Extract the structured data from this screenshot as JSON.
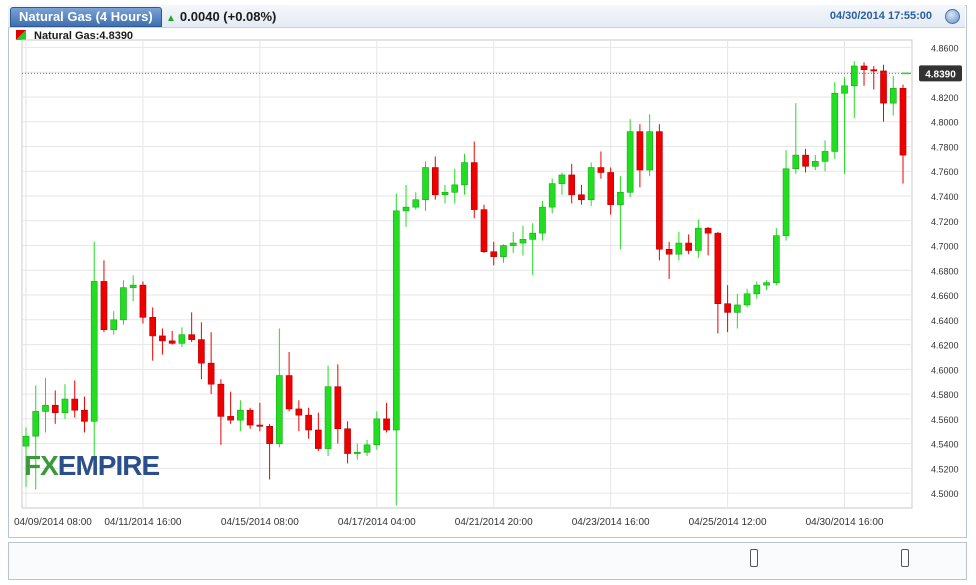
{
  "header": {
    "title": "Natural Gas (4 Hours)",
    "change": "0.0040 (+0.08%)",
    "datetime": "04/30/2014 17:55:00"
  },
  "legend": {
    "label": "Natural Gas:4.8390"
  },
  "watermark": {
    "fx": "FX",
    "rest": "EMPIRE"
  },
  "colors": {
    "up": "#22dd22",
    "down": "#ee0000",
    "axis_text": "#333333",
    "grid": "#e6e6e6",
    "price_tag": "#333333"
  },
  "chart_data": {
    "type": "candlestick",
    "title": "Natural Gas (4 Hours)",
    "ylim": [
      4.488,
      4.866
    ],
    "y_ticks": [
      "4.8600",
      "4.8400",
      "4.8200",
      "4.8000",
      "4.7800",
      "4.7600",
      "4.7400",
      "4.7200",
      "4.7000",
      "4.6800",
      "4.6600",
      "4.6400",
      "4.6200",
      "4.6000",
      "4.5800",
      "4.5600",
      "4.5400",
      "4.5200",
      "4.5000"
    ],
    "x_ticks": [
      {
        "index": 0,
        "label": "04/09/2014 08:00"
      },
      {
        "index": 12,
        "label": "04/11/2014 16:00"
      },
      {
        "index": 24,
        "label": "04/15/2014 08:00"
      },
      {
        "index": 36,
        "label": "04/17/2014 04:00"
      },
      {
        "index": 48,
        "label": "04/21/2014 20:00"
      },
      {
        "index": 60,
        "label": "04/23/2014 16:00"
      },
      {
        "index": 72,
        "label": "04/25/2014 12:00"
      },
      {
        "index": 84,
        "label": "04/30/2014 16:00"
      }
    ],
    "last_price": "4.8390",
    "candles": [
      {
        "o": 4.538,
        "h": 4.553,
        "l": 4.505,
        "c": 4.546
      },
      {
        "o": 4.546,
        "h": 4.587,
        "l": 4.503,
        "c": 4.566
      },
      {
        "o": 4.566,
        "h": 4.593,
        "l": 4.549,
        "c": 4.571
      },
      {
        "o": 4.571,
        "h": 4.583,
        "l": 4.556,
        "c": 4.565
      },
      {
        "o": 4.565,
        "h": 4.588,
        "l": 4.56,
        "c": 4.576
      },
      {
        "o": 4.576,
        "h": 4.591,
        "l": 4.561,
        "c": 4.567
      },
      {
        "o": 4.567,
        "h": 4.578,
        "l": 4.549,
        "c": 4.558
      },
      {
        "o": 4.558,
        "h": 4.703,
        "l": 4.527,
        "c": 4.671
      },
      {
        "o": 4.671,
        "h": 4.688,
        "l": 4.63,
        "c": 4.632
      },
      {
        "o": 4.632,
        "h": 4.647,
        "l": 4.628,
        "c": 4.64
      },
      {
        "o": 4.64,
        "h": 4.672,
        "l": 4.636,
        "c": 4.666
      },
      {
        "o": 4.666,
        "h": 4.676,
        "l": 4.655,
        "c": 4.668
      },
      {
        "o": 4.668,
        "h": 4.671,
        "l": 4.637,
        "c": 4.642
      },
      {
        "o": 4.642,
        "h": 4.65,
        "l": 4.607,
        "c": 4.627
      },
      {
        "o": 4.627,
        "h": 4.633,
        "l": 4.612,
        "c": 4.623
      },
      {
        "o": 4.623,
        "h": 4.631,
        "l": 4.62,
        "c": 4.621
      },
      {
        "o": 4.621,
        "h": 4.634,
        "l": 4.618,
        "c": 4.628
      },
      {
        "o": 4.628,
        "h": 4.646,
        "l": 4.622,
        "c": 4.624
      },
      {
        "o": 4.624,
        "h": 4.638,
        "l": 4.592,
        "c": 4.605
      },
      {
        "o": 4.605,
        "h": 4.63,
        "l": 4.58,
        "c": 4.588
      },
      {
        "o": 4.588,
        "h": 4.592,
        "l": 4.539,
        "c": 4.562
      },
      {
        "o": 4.562,
        "h": 4.582,
        "l": 4.556,
        "c": 4.559
      },
      {
        "o": 4.559,
        "h": 4.575,
        "l": 4.55,
        "c": 4.567
      },
      {
        "o": 4.567,
        "h": 4.569,
        "l": 4.552,
        "c": 4.555
      },
      {
        "o": 4.555,
        "h": 4.573,
        "l": 4.55,
        "c": 4.554
      },
      {
        "o": 4.554,
        "h": 4.556,
        "l": 4.511,
        "c": 4.54
      },
      {
        "o": 4.54,
        "h": 4.633,
        "l": 4.537,
        "c": 4.595
      },
      {
        "o": 4.595,
        "h": 4.614,
        "l": 4.566,
        "c": 4.568
      },
      {
        "o": 4.568,
        "h": 4.575,
        "l": 4.55,
        "c": 4.563
      },
      {
        "o": 4.563,
        "h": 4.569,
        "l": 4.544,
        "c": 4.551
      },
      {
        "o": 4.551,
        "h": 4.565,
        "l": 4.534,
        "c": 4.536
      },
      {
        "o": 4.536,
        "h": 4.603,
        "l": 4.53,
        "c": 4.586
      },
      {
        "o": 4.586,
        "h": 4.604,
        "l": 4.54,
        "c": 4.552
      },
      {
        "o": 4.552,
        "h": 4.558,
        "l": 4.524,
        "c": 4.532
      },
      {
        "o": 4.532,
        "h": 4.54,
        "l": 4.527,
        "c": 4.533
      },
      {
        "o": 4.533,
        "h": 4.543,
        "l": 4.53,
        "c": 4.539
      },
      {
        "o": 4.539,
        "h": 4.566,
        "l": 4.535,
        "c": 4.56
      },
      {
        "o": 4.56,
        "h": 4.573,
        "l": 4.549,
        "c": 4.551
      },
      {
        "o": 4.551,
        "h": 4.742,
        "l": 4.49,
        "c": 4.728
      },
      {
        "o": 4.728,
        "h": 4.749,
        "l": 4.715,
        "c": 4.731
      },
      {
        "o": 4.731,
        "h": 4.743,
        "l": 4.729,
        "c": 4.737
      },
      {
        "o": 4.737,
        "h": 4.768,
        "l": 4.728,
        "c": 4.763
      },
      {
        "o": 4.763,
        "h": 4.772,
        "l": 4.737,
        "c": 4.741
      },
      {
        "o": 4.741,
        "h": 4.749,
        "l": 4.734,
        "c": 4.743
      },
      {
        "o": 4.743,
        "h": 4.762,
        "l": 4.734,
        "c": 4.749
      },
      {
        "o": 4.749,
        "h": 4.774,
        "l": 4.741,
        "c": 4.767
      },
      {
        "o": 4.767,
        "h": 4.784,
        "l": 4.722,
        "c": 4.729
      },
      {
        "o": 4.729,
        "h": 4.733,
        "l": 4.694,
        "c": 4.695
      },
      {
        "o": 4.695,
        "h": 4.703,
        "l": 4.684,
        "c": 4.691
      },
      {
        "o": 4.691,
        "h": 4.701,
        "l": 4.686,
        "c": 4.7
      },
      {
        "o": 4.7,
        "h": 4.711,
        "l": 4.694,
        "c": 4.702
      },
      {
        "o": 4.702,
        "h": 4.716,
        "l": 4.692,
        "c": 4.705
      },
      {
        "o": 4.705,
        "h": 4.718,
        "l": 4.676,
        "c": 4.71
      },
      {
        "o": 4.71,
        "h": 4.736,
        "l": 4.704,
        "c": 4.731
      },
      {
        "o": 4.731,
        "h": 4.754,
        "l": 4.726,
        "c": 4.75
      },
      {
        "o": 4.75,
        "h": 4.759,
        "l": 4.741,
        "c": 4.757
      },
      {
        "o": 4.757,
        "h": 4.766,
        "l": 4.734,
        "c": 4.741
      },
      {
        "o": 4.741,
        "h": 4.749,
        "l": 4.733,
        "c": 4.737
      },
      {
        "o": 4.737,
        "h": 4.767,
        "l": 4.732,
        "c": 4.763
      },
      {
        "o": 4.763,
        "h": 4.776,
        "l": 4.754,
        "c": 4.759
      },
      {
        "o": 4.759,
        "h": 4.763,
        "l": 4.725,
        "c": 4.733
      },
      {
        "o": 4.733,
        "h": 4.756,
        "l": 4.697,
        "c": 4.743
      },
      {
        "o": 4.743,
        "h": 4.802,
        "l": 4.739,
        "c": 4.792
      },
      {
        "o": 4.792,
        "h": 4.798,
        "l": 4.747,
        "c": 4.761
      },
      {
        "o": 4.761,
        "h": 4.806,
        "l": 4.756,
        "c": 4.792
      },
      {
        "o": 4.792,
        "h": 4.798,
        "l": 4.688,
        "c": 4.697
      },
      {
        "o": 4.697,
        "h": 4.703,
        "l": 4.673,
        "c": 4.693
      },
      {
        "o": 4.693,
        "h": 4.711,
        "l": 4.688,
        "c": 4.702
      },
      {
        "o": 4.702,
        "h": 4.709,
        "l": 4.693,
        "c": 4.696
      },
      {
        "o": 4.696,
        "h": 4.721,
        "l": 4.69,
        "c": 4.714
      },
      {
        "o": 4.714,
        "h": 4.715,
        "l": 4.692,
        "c": 4.71
      },
      {
        "o": 4.71,
        "h": 4.711,
        "l": 4.629,
        "c": 4.653
      },
      {
        "o": 4.653,
        "h": 4.668,
        "l": 4.63,
        "c": 4.646
      },
      {
        "o": 4.646,
        "h": 4.661,
        "l": 4.633,
        "c": 4.652
      },
      {
        "o": 4.652,
        "h": 4.665,
        "l": 4.65,
        "c": 4.661
      },
      {
        "o": 4.661,
        "h": 4.671,
        "l": 4.657,
        "c": 4.668
      },
      {
        "o": 4.668,
        "h": 4.672,
        "l": 4.664,
        "c": 4.67
      },
      {
        "o": 4.67,
        "h": 4.714,
        "l": 4.668,
        "c": 4.708
      },
      {
        "o": 4.708,
        "h": 4.777,
        "l": 4.704,
        "c": 4.762
      },
      {
        "o": 4.762,
        "h": 4.815,
        "l": 4.758,
        "c": 4.773
      },
      {
        "o": 4.773,
        "h": 4.778,
        "l": 4.759,
        "c": 4.764
      },
      {
        "o": 4.764,
        "h": 4.773,
        "l": 4.761,
        "c": 4.768
      },
      {
        "o": 4.768,
        "h": 4.785,
        "l": 4.76,
        "c": 4.776
      },
      {
        "o": 4.776,
        "h": 4.832,
        "l": 4.77,
        "c": 4.823
      },
      {
        "o": 4.823,
        "h": 4.836,
        "l": 4.758,
        "c": 4.829
      },
      {
        "o": 4.829,
        "h": 4.849,
        "l": 4.803,
        "c": 4.845
      },
      {
        "o": 4.845,
        "h": 4.848,
        "l": 4.829,
        "c": 4.842
      },
      {
        "o": 4.842,
        "h": 4.845,
        "l": 4.826,
        "c": 4.841
      },
      {
        "o": 4.841,
        "h": 4.846,
        "l": 4.8,
        "c": 4.815
      },
      {
        "o": 4.815,
        "h": 4.837,
        "l": 4.805,
        "c": 4.827
      },
      {
        "o": 4.827,
        "h": 4.83,
        "l": 4.75,
        "c": 4.773
      }
    ]
  }
}
